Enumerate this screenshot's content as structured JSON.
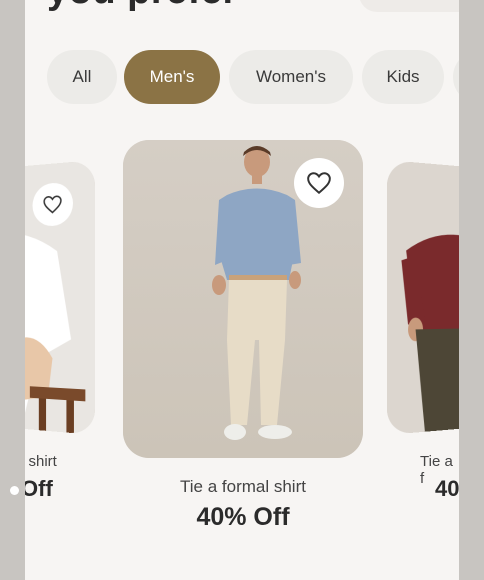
{
  "header": {
    "headline": "you prefer"
  },
  "categories": [
    {
      "label": "All",
      "active": false
    },
    {
      "label": "Men's",
      "active": true
    },
    {
      "label": "Women's",
      "active": false
    },
    {
      "label": "Kids",
      "active": false
    }
  ],
  "products": {
    "left": {
      "title": "l shirt",
      "price": "Off"
    },
    "main": {
      "title": "Tie a formal shirt",
      "price": "40% Off"
    },
    "right": {
      "title": "Tie a f",
      "price": "40"
    }
  },
  "colors": {
    "accent": "#8b7345",
    "chip_bg": "#ecebe8",
    "background": "#f7f5f3"
  },
  "icons": {
    "favorite": "heart-outline-icon"
  }
}
